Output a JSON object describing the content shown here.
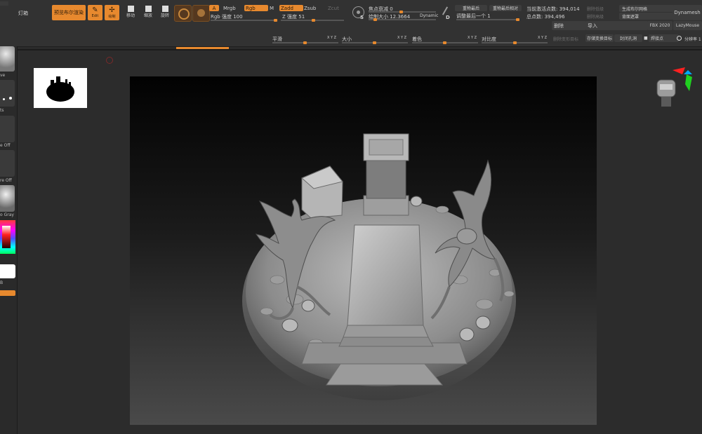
{
  "topbar": {
    "menu_label": "灯箱",
    "preview_button": "预览布尔渲染",
    "edit_label": "Edit",
    "draw_label": "绘制",
    "move_label": "移动",
    "scale_label": "缩放",
    "rotate_label": "旋转",
    "a_label": "A",
    "mrgb_label": "Mrgb",
    "rgb_label": "Rgb",
    "m_label": "M",
    "zadd_label": "Zadd",
    "zsub_label": "Zsub",
    "zcut_label": "Zcut",
    "rgb_intensity": "Rgb 强度 100",
    "z_intensity": "Z 强度 51",
    "s_letter": "S",
    "focal_shift": "焦点衰减 0",
    "draw_size": "绘制大小 12.3664",
    "dynamic_label": "Dynamic",
    "d_letter": "D",
    "recent_a": "重物最后",
    "recent_b": "重物最后相对",
    "adjust_last": "调整最后一个 1",
    "active_points": "当前激活点数: 394,014",
    "total_points": "总点数: 394,496",
    "delete_a": "删除低级",
    "delete_b": "删除高级",
    "gen_boolean": "生成布尔网格",
    "back_mask": "背面遮罩",
    "dynamesh_label": "Dynamesh",
    "delete_btn": "删除",
    "import_btn": "导入",
    "fbx_label": "FBX 2020",
    "lazymouse_label": "LazyMouse",
    "del_hidden": "删除变形目标",
    "save_as_target": "存储变换目标",
    "close_holes": "封闭孔洞",
    "weld_points": "焊接点",
    "resolution": "分辨率 1"
  },
  "secondbar": {
    "smooth": "平滑",
    "size": "大小",
    "noise": "着色",
    "contrast": "对比度",
    "xyz1": "X Y Z",
    "xyz2": "X Y Z",
    "xyz3": "X Y Z",
    "xyz4": "X Y Z"
  },
  "lefttray": {
    "item1": "ve",
    "item2": "ts",
    "item3": "e Off",
    "item4": "re Off",
    "item5": "o Gray",
    "item6": "B"
  }
}
